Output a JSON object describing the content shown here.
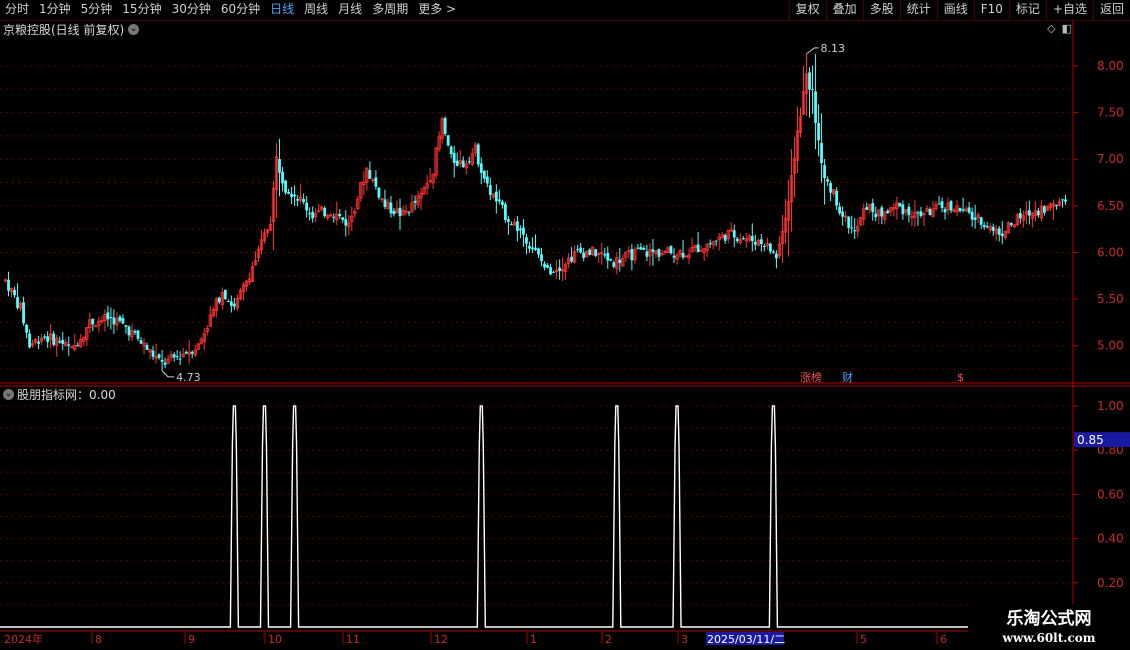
{
  "toolbar": {
    "periods": [
      "分时",
      "1分钟",
      "5分钟",
      "15分钟",
      "30分钟",
      "60分钟",
      "日线",
      "周线",
      "月线",
      "多周期",
      "更多 >"
    ],
    "active_period": "日线",
    "tools": [
      "复权",
      "叠加",
      "多股",
      "统计",
      "画线",
      "F10",
      "标记",
      "+自选",
      "返回"
    ]
  },
  "main_chart": {
    "title": "京粮控股(日线 前复权)",
    "high_label": "8.13",
    "low_label": "4.73",
    "price_ticks": [
      "8.00",
      "7.50",
      "7.00",
      "6.50",
      "6.00",
      "5.50",
      "5.00"
    ],
    "event_markers": [
      "涨榜",
      "财",
      "$"
    ]
  },
  "indicator": {
    "title": "股朋指标网：0.00",
    "ticks": [
      "1.00",
      "0.80",
      "0.60",
      "0.40",
      "0.20"
    ],
    "cursor_value": "0.85"
  },
  "date_axis": {
    "labels": [
      "2024年",
      "8",
      "9",
      "10",
      "11",
      "12",
      "1",
      "2",
      "3",
      "2025/03/11/二",
      "5",
      "6"
    ],
    "highlight": "2025/03/11/二"
  },
  "watermark": {
    "title": "乐淘公式网",
    "url": "www.60lt.com"
  },
  "colors": {
    "up": "#ff3232",
    "down": "#54fcfc",
    "axis": "#b00000",
    "grid": "#5a0000",
    "signal": "#ffffff",
    "highlight_bg": "#1a1aa0"
  },
  "chart_data": {
    "type": "candlestick",
    "ylim": [
      4.6,
      8.3
    ],
    "x_labels": [
      "2024年",
      "8",
      "9",
      "10",
      "11",
      "12",
      "1",
      "2",
      "3",
      "2025/03/11/二",
      "5",
      "6"
    ],
    "price_anchors": [
      [
        0,
        5.7
      ],
      [
        5,
        5.4
      ],
      [
        8,
        5.0
      ],
      [
        12,
        5.1
      ],
      [
        18,
        5.05
      ],
      [
        22,
        4.95
      ],
      [
        28,
        5.25
      ],
      [
        35,
        5.3
      ],
      [
        40,
        5.2
      ],
      [
        46,
        5.0
      ],
      [
        52,
        4.8
      ],
      [
        58,
        4.9
      ],
      [
        64,
        5.0
      ],
      [
        68,
        5.3
      ],
      [
        72,
        5.6
      ],
      [
        76,
        5.4
      ],
      [
        80,
        5.7
      ],
      [
        84,
        6.0
      ],
      [
        88,
        6.35
      ],
      [
        90,
        7.0
      ],
      [
        93,
        6.7
      ],
      [
        97,
        6.6
      ],
      [
        102,
        6.4
      ],
      [
        108,
        6.45
      ],
      [
        114,
        6.3
      ],
      [
        120,
        6.9
      ],
      [
        126,
        6.5
      ],
      [
        132,
        6.4
      ],
      [
        138,
        6.6
      ],
      [
        142,
        6.9
      ],
      [
        145,
        7.4
      ],
      [
        148,
        7.0
      ],
      [
        152,
        6.95
      ],
      [
        156,
        7.1
      ],
      [
        160,
        6.7
      ],
      [
        166,
        6.4
      ],
      [
        172,
        6.2
      ],
      [
        176,
        6.0
      ],
      [
        180,
        5.8
      ],
      [
        184,
        5.85
      ],
      [
        190,
        6.0
      ],
      [
        196,
        6.0
      ],
      [
        202,
        5.9
      ],
      [
        210,
        6.0
      ],
      [
        218,
        6.0
      ],
      [
        226,
        6.0
      ],
      [
        234,
        6.1
      ],
      [
        240,
        6.2
      ],
      [
        246,
        6.15
      ],
      [
        252,
        6.1
      ],
      [
        256,
        5.95
      ],
      [
        260,
        6.5
      ],
      [
        263,
        7.3
      ],
      [
        266,
        7.9
      ],
      [
        268,
        7.7
      ],
      [
        271,
        6.9
      ],
      [
        274,
        6.7
      ],
      [
        278,
        6.4
      ],
      [
        282,
        6.2
      ],
      [
        286,
        6.5
      ],
      [
        290,
        6.4
      ],
      [
        296,
        6.5
      ],
      [
        302,
        6.4
      ],
      [
        308,
        6.45
      ],
      [
        314,
        6.5
      ],
      [
        320,
        6.4
      ],
      [
        326,
        6.3
      ],
      [
        330,
        6.2
      ],
      [
        336,
        6.35
      ],
      [
        342,
        6.45
      ],
      [
        348,
        6.5
      ],
      [
        352,
        6.6
      ]
    ],
    "signal": {
      "ylim": [
        0,
        1
      ],
      "spike_value": 1.0,
      "baseline": 0.0,
      "spike_positions": [
        76,
        86,
        96,
        158,
        203,
        223,
        255
      ]
    }
  }
}
